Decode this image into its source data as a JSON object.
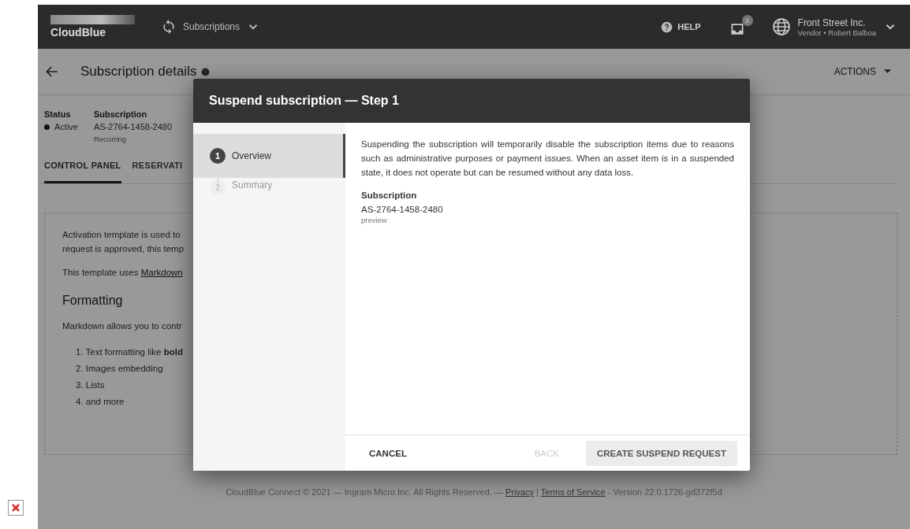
{
  "topbar": {
    "logo": "CloudBlue",
    "module": "Subscriptions",
    "help": "HELP",
    "notifications_badge": "2",
    "account": {
      "name": "Front Street Inc.",
      "role": "Vendor • Robert Balboa"
    }
  },
  "page": {
    "title": "Subscription details",
    "actions": "ACTIONS",
    "fields": [
      {
        "kind": "status",
        "label": "Status",
        "value": "Active"
      },
      {
        "kind": "text",
        "label": "Subscription",
        "value": "AS-2764-1458-2480",
        "note": "Recurring"
      }
    ],
    "tabs": [
      {
        "label": "CONTROL PANEL",
        "selected": true
      },
      {
        "label": "RESERVATI",
        "selected": false
      }
    ],
    "template": {
      "intro": [
        "Activation template is used to",
        "request is approved, this temp"
      ],
      "markdown_text": "This template uses",
      "markdown_link": "Markdown",
      "heading": "Formatting",
      "paragraph": "Markdown allows you to contr",
      "list": [
        "1. Text formatting like **bold**",
        "2. Images embedding",
        "3. Lists",
        "4. and more"
      ]
    }
  },
  "modal": {
    "title": "Suspend subscription — Step 1",
    "steps": [
      {
        "number": "1",
        "label": "Overview",
        "selected": true
      },
      {
        "number": "2",
        "label": "Summary",
        "selected": false
      }
    ],
    "description": "Suspending the subscription will temporarily disable the subscription items due to reasons such as administrative purposes or payment issues. When an asset item is in a suspended state, it does not operate but can be resumed without any data loss.",
    "field_label": "Subscription",
    "field_value": "AS-2764-1458-2480",
    "field_note": "preview",
    "buttons": [
      {
        "kind": "text",
        "label": "CANCEL",
        "disabled": false
      },
      {
        "kind": "text",
        "label": "BACK",
        "disabled": true
      },
      {
        "kind": "filled",
        "label": "CREATE SUSPEND REQUEST",
        "disabled": false
      }
    ]
  },
  "footer": {
    "text_before": "CloudBlue Connect © 2021 — Ingram Micro Inc. All Rights Reserved. —",
    "links": [
      "Privacy",
      "Terms of Service"
    ],
    "separator": "|",
    "text_after": "- Version 22.0.1726-gd372f5d"
  }
}
